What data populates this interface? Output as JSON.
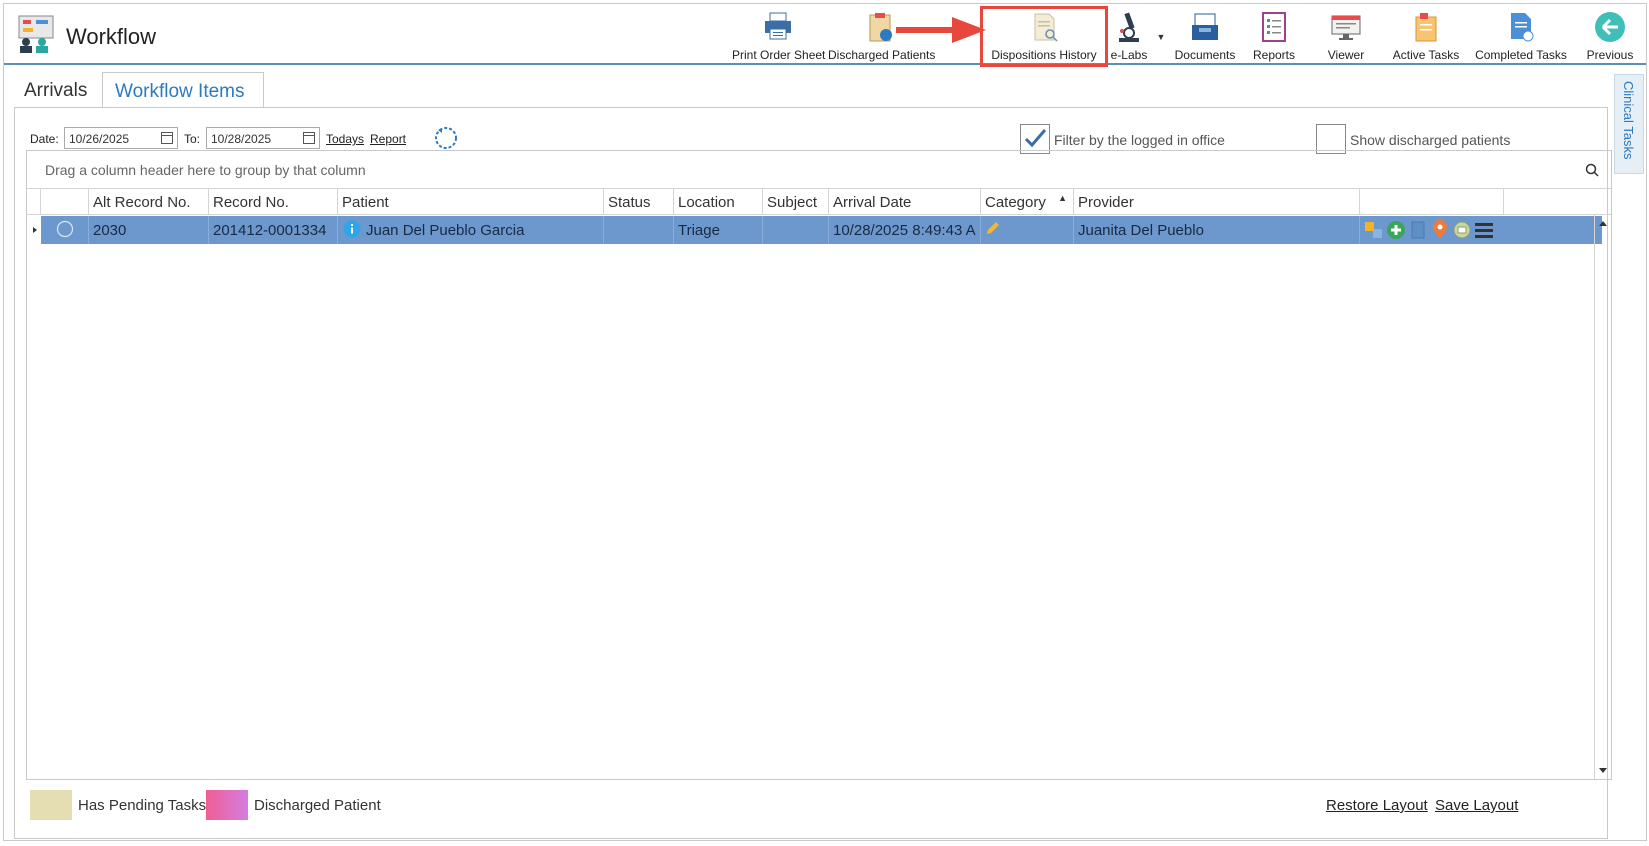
{
  "app": {
    "title": "Workflow"
  },
  "toolbar": {
    "print_order_sheet": "Print Order Sheet",
    "discharged_patients": "Discharged Patients",
    "dispositions_history": "Dispositions History",
    "e_labs": "e-Labs",
    "documents": "Documents",
    "reports": "Reports",
    "viewer": "Viewer",
    "active_tasks": "Active Tasks",
    "completed_tasks": "Completed Tasks",
    "previous": "Previous"
  },
  "tabs": {
    "arrivals": "Arrivals",
    "workflow_items": "Workflow Items"
  },
  "side_tab": {
    "label": "Clinical Tasks"
  },
  "filter": {
    "date_label": "Date:",
    "date_from": "10/26/2025",
    "to_label": "To:",
    "date_to": "10/28/2025",
    "todays": "Todays",
    "report": "Report",
    "filter_logged_office": "Filter by the logged in office",
    "filter_logged_office_checked": true,
    "show_discharged": "Show discharged patients",
    "show_discharged_checked": false
  },
  "grid": {
    "group_prompt": "Drag a column header here to group by that column",
    "columns": [
      "Alt Record No.",
      "Record No.",
      "Patient",
      "Status",
      "Location",
      "Subject",
      "Arrival Date",
      "Category",
      "Provider"
    ],
    "rows": [
      {
        "alt_record": "2030",
        "record": "201412-0001334",
        "patient": "Juan Del Pueblo Garcia",
        "status": "",
        "location": "Triage",
        "subject": "",
        "arrival_date": "10/28/2025 8:49:43 A",
        "category": "",
        "provider": "Juanita Del Pueblo"
      }
    ]
  },
  "legend": {
    "pending": "Has Pending Tasks",
    "discharged": "Discharged Patient",
    "restore_layout": "Restore Layout",
    "save_layout": "Save Layout"
  },
  "colors": {
    "selected_row": "#6c98cd",
    "accent": "#2a7bc0",
    "highlight_box": "#e8483c",
    "pending_swatch": "#e6deb3"
  }
}
